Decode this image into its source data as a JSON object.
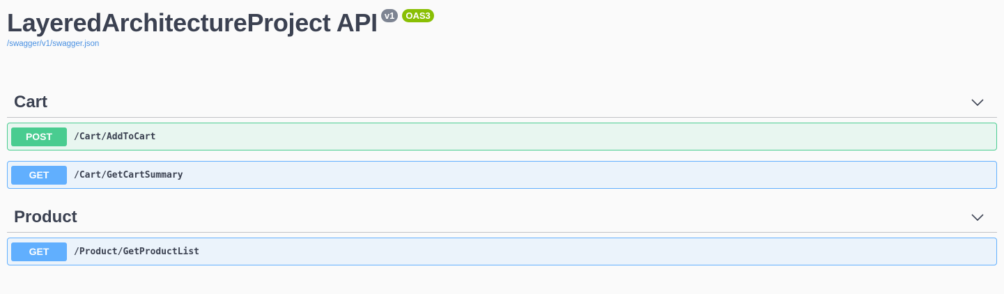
{
  "info": {
    "title": "LayeredArchitectureProject API",
    "version_badge": "v1",
    "oas_badge": "OAS3",
    "spec_link": "/swagger/v1/swagger.json"
  },
  "sections": [
    {
      "name": "Cart",
      "chevron_icon": "chevron-down-icon",
      "operations": [
        {
          "method": "POST",
          "path": "/Cart/AddToCart"
        },
        {
          "method": "GET",
          "path": "/Cart/GetCartSummary"
        }
      ]
    },
    {
      "name": "Product",
      "chevron_icon": "chevron-down-icon",
      "operations": [
        {
          "method": "GET",
          "path": "/Product/GetProductList"
        }
      ]
    }
  ],
  "colors": {
    "post": "#49cc90",
    "get": "#61afe",
    "link": "#4990e2",
    "oas_badge": "#89bf04",
    "version_badge": "#7d8492"
  }
}
